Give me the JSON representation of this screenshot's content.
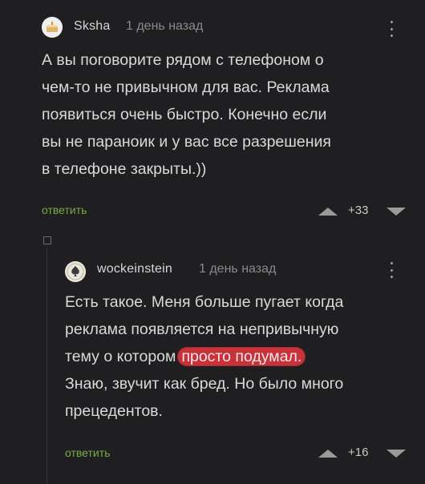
{
  "comments": [
    {
      "author": "Sksha",
      "time": "1 день назад",
      "lines": [
        "А вы поговорите рядом с телефоном о",
        "чем-то не привычном для вас. Реклама",
        "появиться очень быстро. Конечно если",
        "вы не параноик и у вас все разрешения",
        "в телефоне закрыты.))"
      ],
      "reply_label": "ответить",
      "rating": "+33"
    },
    {
      "author": "wockeinstein",
      "time": "1 день назад",
      "lines": [
        "Есть такое. Меня больше пугает когда",
        "реклама появляется на непривычную",
        "тему о котором",
        "Знаю, звучит как бред. Но было много",
        "прецедентов."
      ],
      "highlighted": "просто подумал.",
      "reply_label": "ответить",
      "rating": "+16"
    }
  ],
  "icons": {
    "avatar_1": "cake-avatar",
    "avatar_2": "spade-avatar",
    "more": "more-vertical-icon",
    "up": "vote-up-icon",
    "down": "vote-down-icon",
    "collapse": "collapse-thread-icon"
  },
  "colors": {
    "background": "#1f1f21",
    "reply": "#8bc34a",
    "highlight": "#c8323a"
  }
}
